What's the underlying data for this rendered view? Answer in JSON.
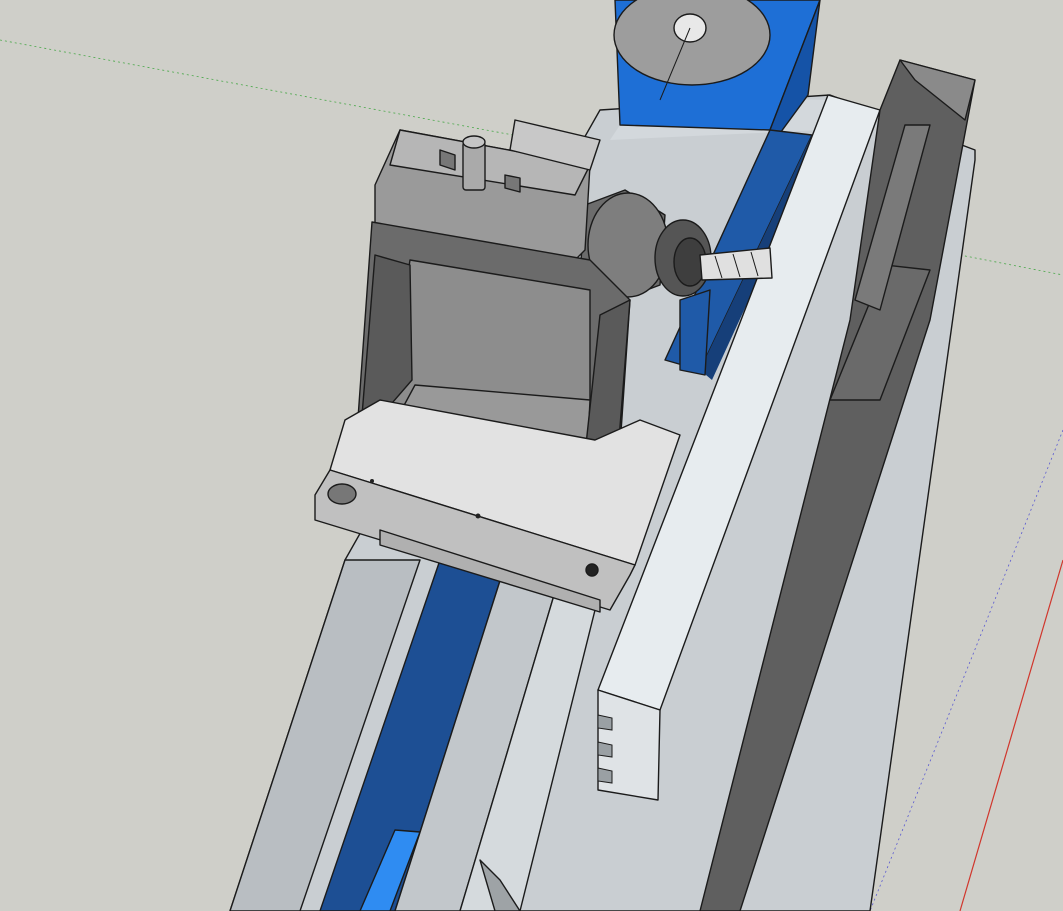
{
  "viewport": {
    "background_color": "#cfcfc9",
    "content": "3d-model-view"
  },
  "colors": {
    "bed_metal": "#c9ced2",
    "bed_metal_light": "#dde2e6",
    "blue_rail": "#1f5aa8",
    "blue_bright": "#2f8cf2",
    "fixture_gray": "#8c8c8c",
    "fixture_dark": "#5e5e5e",
    "fixture_light": "#b5b5b5",
    "axis_red": "#d0362c",
    "axis_green": "#4aa84a",
    "axis_blue": "#5a5ad0"
  },
  "model_parts": [
    "lathe-bed",
    "carriage-rail-blue",
    "angle-plate-fixture",
    "milling-vise",
    "collet-chuck",
    "end-mill",
    "tool-rest-bar",
    "side-wall",
    "spindle-pulley"
  ]
}
